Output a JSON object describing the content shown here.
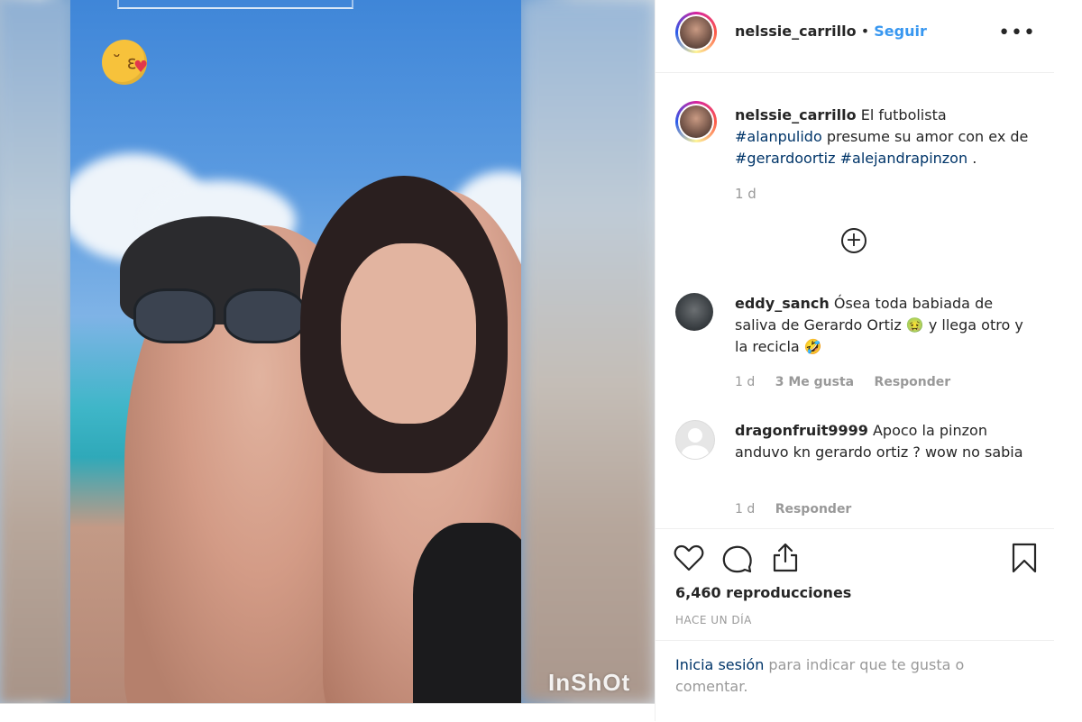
{
  "post": {
    "username": "nelssie_carrillo",
    "separator": "•",
    "follow_label": "Seguir",
    "more_label": "•••",
    "caption": {
      "user": "nelssie_carrillo",
      "text1": "El futbolista",
      "tag1": "#alanpulido",
      "text2": "presume su amor con ex de",
      "tag2": "#gerardoortiz",
      "tag3": "#alejandrapinzon",
      "text3": ".",
      "time": "1 d"
    },
    "load_more_label": "+"
  },
  "comments": [
    {
      "user": "eddy_sanch",
      "text": "Ósea toda babiada de saliva de Gerardo Ortiz 🤢 y llega otro y la recicla 🤣",
      "time": "1 d",
      "likes": "3 Me gusta",
      "reply": "Responder"
    },
    {
      "user": "dragonfruit9999",
      "text": "Apoco la pinzon anduvo kn gerardo ortiz ? wow no sabia",
      "time": "1 d",
      "reply": "Responder"
    }
  ],
  "stats": {
    "views": "6,460 reproducciones",
    "posted": "HACE UN DÍA"
  },
  "login": {
    "link": "Inicia sesión",
    "text": "para indicar que te gusta o comentar."
  },
  "media": {
    "watermark": "InShOt"
  },
  "icons": {
    "like": "heart-icon",
    "comment": "comment-icon",
    "share": "share-icon",
    "save": "bookmark-icon",
    "more": "more-options-icon",
    "emoji": "kiss-emoji-icon"
  },
  "colors": {
    "link": "#3897f0",
    "hashtag": "#003569",
    "meta": "#999999"
  }
}
